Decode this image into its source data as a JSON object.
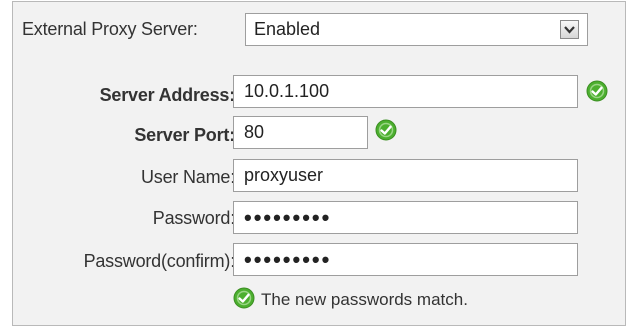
{
  "proxy": {
    "label": "External Proxy Server:",
    "selected": "Enabled"
  },
  "server_address": {
    "label": "Server Address:",
    "value": "10.0.1.100"
  },
  "server_port": {
    "label": "Server Port:",
    "value": "80"
  },
  "user_name": {
    "label": "User Name:",
    "value": "proxyuser"
  },
  "password": {
    "label": "Password:",
    "value": "•••••••••"
  },
  "password_confirm": {
    "label": "Password(confirm):",
    "value": "•••••••••"
  },
  "match_message": "The new passwords match.",
  "icons": {
    "valid": "check-circle-icon",
    "dropdown": "chevron-down-icon"
  },
  "colors": {
    "valid_green": "#4caf2f",
    "panel_bg": "#f2f2f2"
  }
}
